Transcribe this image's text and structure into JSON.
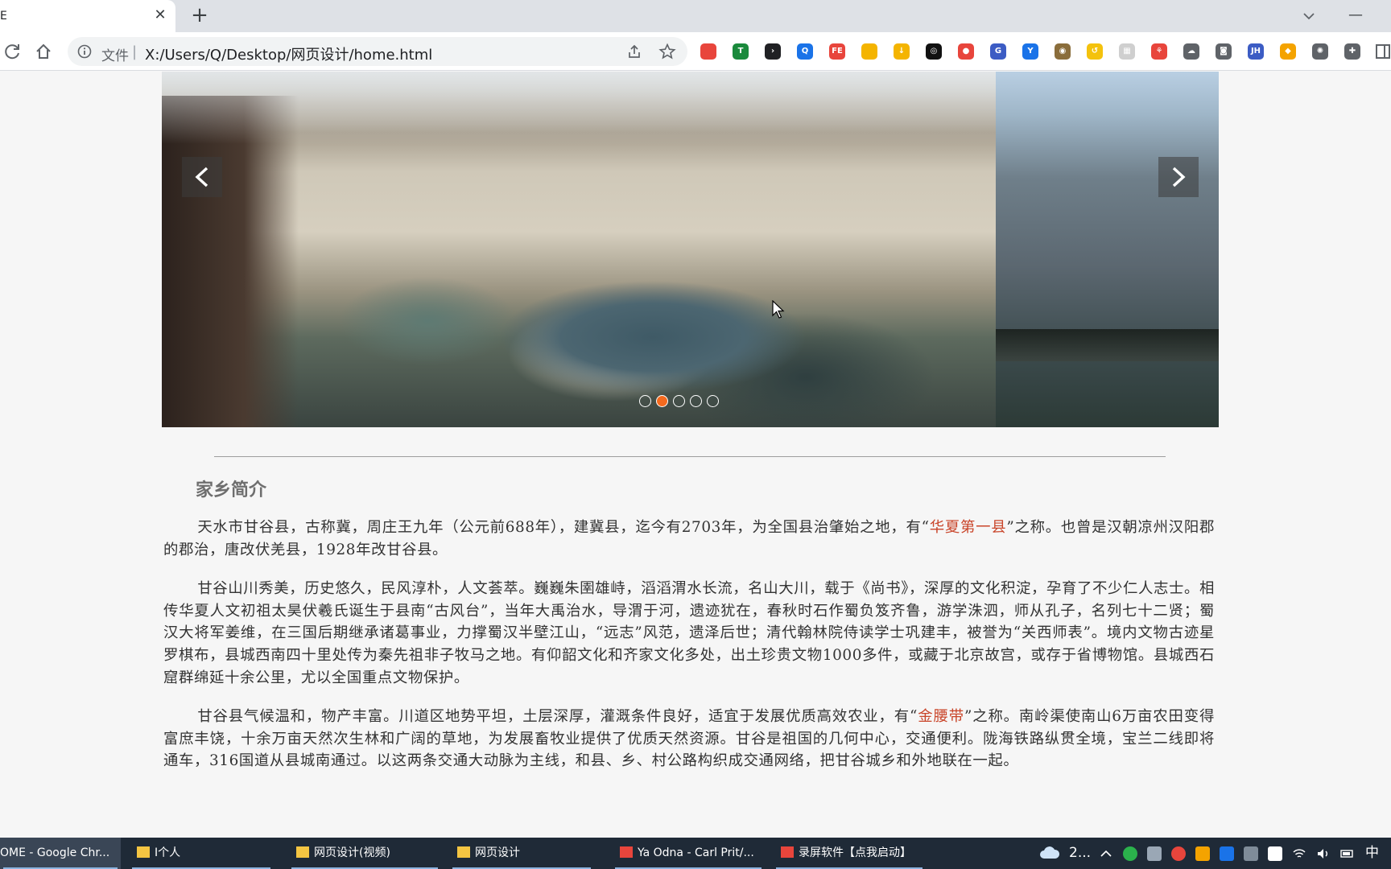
{
  "browser": {
    "tab_title": "E",
    "tab_close": "✕",
    "new_tab": "+",
    "address_label": "文件",
    "address_separator": "|",
    "url": "X:/Users/Q/Desktop/网页设计/home.html"
  },
  "extensions": [
    {
      "name": "chrome-ext-1",
      "color": "#e8453c",
      "glyph": ""
    },
    {
      "name": "shield-ext",
      "color": "#1a8a3c",
      "glyph": "T"
    },
    {
      "name": "terminal-ext",
      "color": "#202124",
      "glyph": "›"
    },
    {
      "name": "search-ext",
      "color": "#1a73e8",
      "glyph": "Q"
    },
    {
      "name": "fe-ext",
      "color": "#e8453c",
      "glyph": "FE"
    },
    {
      "name": "chrome-ext-2",
      "color": "#f4b400",
      "glyph": ""
    },
    {
      "name": "download-ext",
      "color": "#f4b400",
      "glyph": "↓"
    },
    {
      "name": "dark-ext",
      "color": "#111111",
      "glyph": "◎"
    },
    {
      "name": "stop-ext",
      "color": "#e8453c",
      "glyph": "●"
    },
    {
      "name": "g-ext",
      "color": "#3c5cc4",
      "glyph": "G"
    },
    {
      "name": "y-ext",
      "color": "#1a73e8",
      "glyph": "Y"
    },
    {
      "name": "owl-ext",
      "color": "#8a6d3b",
      "glyph": "◉"
    },
    {
      "name": "yellow-ext",
      "color": "#f4c20d",
      "glyph": "↺"
    },
    {
      "name": "grid-ext",
      "color": "#cfcfcf",
      "glyph": "▦"
    },
    {
      "name": "tree-ext",
      "color": "#e8453c",
      "glyph": "⚘"
    },
    {
      "name": "cloud-ext",
      "color": "#5f6368",
      "glyph": "☁"
    },
    {
      "name": "camera-ext",
      "color": "#5f6368",
      "glyph": "◙"
    },
    {
      "name": "jh-ext",
      "color": "#3c5cc4",
      "glyph": "JH"
    },
    {
      "name": "orange-ext",
      "color": "#f4a300",
      "glyph": "◆"
    },
    {
      "name": "settings-ext",
      "color": "#5f6368",
      "glyph": "✺"
    },
    {
      "name": "puzzle-ext",
      "color": "#5f6368",
      "glyph": "✚"
    }
  ],
  "carousel": {
    "slide_count": 5,
    "active_index": 1
  },
  "section": {
    "title": "家乡简介",
    "paragraphs": [
      {
        "before": "天水市甘谷县，古称冀，周庄王九年（公元前688年），建冀县，迄今有2703年，为全国县治肇始之地，有“",
        "highlight": "华夏第一县",
        "after": "”之称。也曾是汉朝凉州汉阳郡的郡治，唐改伏羌县，1928年改甘谷县。"
      },
      {
        "before": "甘谷山川秀美，历史悠久，民风淳朴，人文荟萃。巍巍朱圉雄峙，滔滔渭水长流，名山大川，载于《尚书》，深厚的文化积淀，孕育了不少仁人志士。相传华夏人文初祖太昊伏羲氏诞生于县南“古风台”，当年大禹治水，导渭于河，遗迹犹在，春秋时石作蜀负笈齐鲁，游学洙泗，师从孔子，名列七十二贤；蜀汉大将军姜维，在三国后期继承诸葛事业，力撑蜀汉半壁江山，“远志”风范，遗泽后世；清代翰林院侍读学士巩建丰，被誉为“关西师表”。境内文物古迹星罗棋布，县城西南四十里处传为秦先祖非子牧马之地。有仰韶文化和齐家文化多处，出土珍贵文物1000多件，或藏于北京故宫，或存于省博物馆。县城西石窟群绵延十余公里，尤以全国重点文物保护。",
        "highlight": "",
        "after": ""
      },
      {
        "before": "甘谷县气候温和，物产丰富。川道区地势平坦，土层深厚，灌溉条件良好，适宜于发展优质高效农业，有“",
        "highlight": "金腰带",
        "after": "”之称。南岭渠使南山6万亩农田变得富庶丰饶，十余万亩天然次生林和广阔的草地，为发展畜牧业提供了优质天然资源。甘谷是祖国的几何中心，交通便利。陇海铁路纵贯全境，宝兰二线即将通车，316国道从县城南通过。以这两条交通大动脉为主线，和县、乡、村公路构织成交通网络，把甘谷城乡和外地联在一起。"
      }
    ]
  },
  "taskbar": {
    "items": [
      {
        "label": "OME - Google Chr...",
        "icon": "chrome-icon",
        "color": "#4285f4",
        "active": true
      },
      {
        "label": "I个人",
        "icon": "folder-icon",
        "color": "#f4c542",
        "active": false
      },
      {
        "label": "网页设计(视频)",
        "icon": "folder-icon",
        "color": "#f4c542",
        "active": false
      },
      {
        "label": "网页设计",
        "icon": "folder-icon",
        "color": "#f4c542",
        "active": false
      },
      {
        "label": "Ya Odna - Carl Prit/...",
        "icon": "music-icon",
        "color": "#e8453c",
        "active": false
      },
      {
        "label": "录屏软件【点我启动】",
        "icon": "recorder-icon",
        "color": "#e8453c",
        "active": false
      }
    ],
    "weather_text": "2...",
    "ime_text": "中"
  },
  "colors": {
    "accent_dot": "#f46a1e",
    "highlight_text": "#c9452a"
  }
}
